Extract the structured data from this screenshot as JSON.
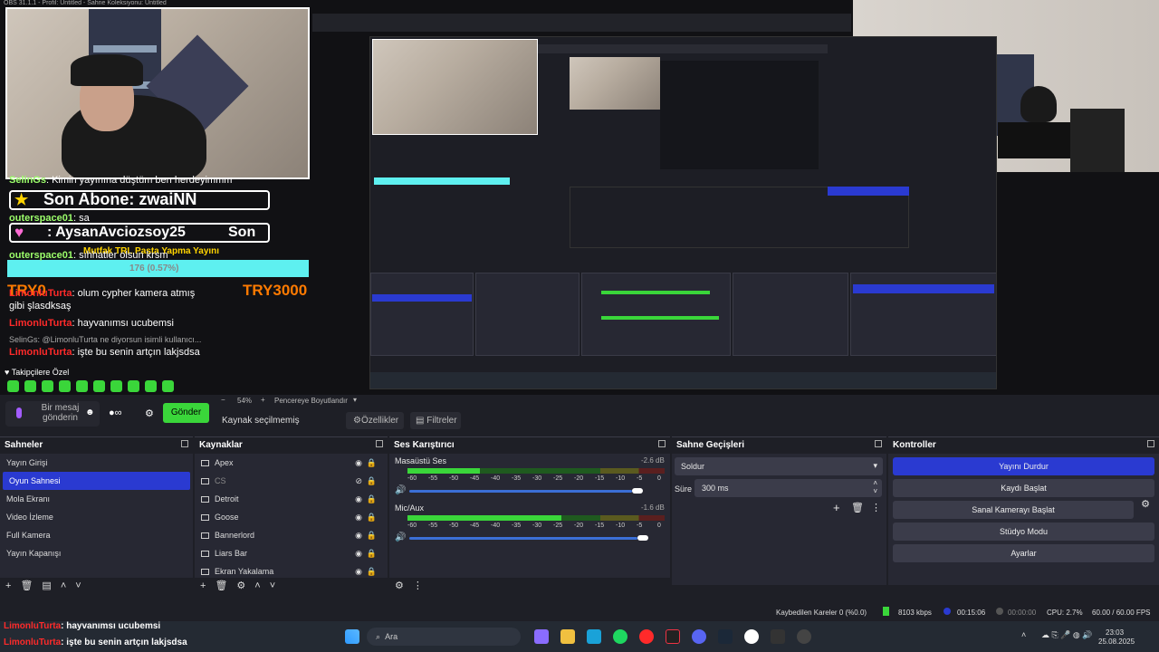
{
  "window": {
    "title": "OBS 31.1.1 - Profil: Untitled - Sahne Koleksiyonu: Untitled"
  },
  "overlay": {
    "sub_alert": "Son Abone: zwaiNN",
    "donation_alert": ": AysanAvciozsoy25",
    "donation_label": "Son",
    "goal_title": "Mutfak TRL Pasta Yapma Yayını",
    "goal_progress_text": "176 (0.57%)",
    "goal_progress": 0.57,
    "goal_left": "TRY0",
    "goal_right": "TRY3000",
    "follower_label": "Takipçilere Özel",
    "chat_placeholder": "Bir mesaj gönderin",
    "send_button": "Gönder"
  },
  "chat": {
    "messages": [
      {
        "user": "SelinGs",
        "text": "Kimin yayınına düştüm ben herdeyimmm"
      },
      {
        "user": "outerspace01",
        "text": "sa"
      },
      {
        "user": "outerspace01",
        "text": "sıhhatler olsun krsm"
      },
      {
        "user": "LimonluTurta",
        "text": "olum cypher kamera atmış gibi şlasdksaş"
      },
      {
        "user": "LimonluTurta",
        "text": "hayvanımsı ucubemsi"
      },
      {
        "user": "LimonluTurta",
        "text": "işte bu senin artçın lakjsdsa"
      }
    ],
    "reply_preview": "SelinGs: @LimonluTurta ne diyorsun isimli kullanıcı..."
  },
  "preview_bar": {
    "zoom": "54%",
    "zoom_label": "Pencereye Boyutlandır"
  },
  "scene_bar": {
    "no_source": "Kaynak seçilmemiş",
    "properties": "Özellikler",
    "filters": "Filtreler"
  },
  "scenes": {
    "title": "Sahneler",
    "items": [
      "Yayın Girişi",
      "Oyun Sahnesi",
      "Mola Ekranı",
      "Video İzleme",
      "Full Kamera",
      "Yayın Kapanışı"
    ],
    "selected": 1
  },
  "sources": {
    "title": "Kaynaklar",
    "items": [
      "Apex",
      "CS",
      "Detroit",
      "Goose",
      "Bannerlord",
      "Liars Bar",
      "Ekran Yakalama"
    ]
  },
  "mixer": {
    "title": "Ses Karıştırıcı",
    "channels": [
      {
        "name": "Masaüstü Ses",
        "db": "-2.6 dB",
        "level": 0.28,
        "volume": 0.88
      },
      {
        "name": "Mic/Aux",
        "db": "-1.6 dB",
        "level": 0.6,
        "volume": 0.9
      }
    ],
    "ticks": [
      "-60",
      "-55",
      "-50",
      "-45",
      "-40",
      "-35",
      "-30",
      "-25",
      "-20",
      "-15",
      "-10",
      "-5",
      "0"
    ]
  },
  "transitions": {
    "title": "Sahne Geçişleri",
    "current": "Soldur",
    "duration_label": "Süre",
    "duration": "300 ms"
  },
  "controls": {
    "title": "Kontroller",
    "buttons": [
      "Yayını Durdur",
      "Kaydı Başlat",
      "Sanal Kamerayı Başlat",
      "Stüdyo Modu",
      "Ayarlar"
    ]
  },
  "status": {
    "dropped": "Kaybedilen Kareler 0 (%0.0)",
    "bitrate": "8103 kbps",
    "stream_time": "00:15:06",
    "rec_time": "00:00:00",
    "cpu": "CPU: 2.7%",
    "fps": "60.00 / 60.00 FPS"
  },
  "taskbar": {
    "search": "Ara",
    "time": "23:03",
    "date": "25.08.2025"
  },
  "colors": {
    "accent": "#2a3ad1",
    "chat_red": "#ff2a2a",
    "meter_green": "#3ad63a",
    "goal_cyan": "#5ef0f0"
  }
}
